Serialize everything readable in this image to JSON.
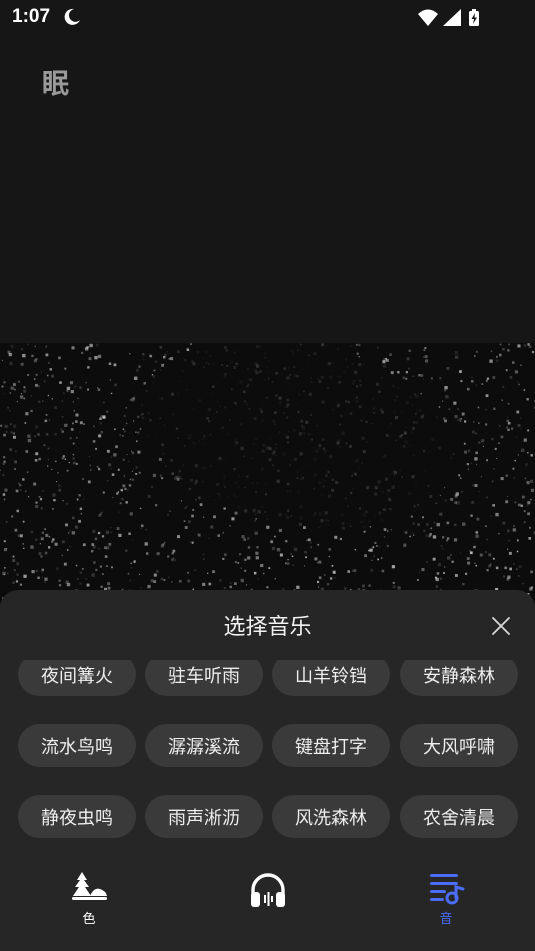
{
  "status_bar": {
    "time": "1:07"
  },
  "app": {
    "logo_text": "眠"
  },
  "sheet": {
    "title": "选择音乐",
    "sounds": [
      "夜间篝火",
      "驻车听雨",
      "山羊铃铛",
      "安静森林",
      "流水鸟鸣",
      "潺潺溪流",
      "键盘打字",
      "大风呼啸",
      "静夜虫鸣",
      "雨声淅沥",
      "风洗森林",
      "农舍清晨"
    ]
  },
  "bottom_nav": {
    "items": [
      {
        "label": "色",
        "icon": "landscape-icon"
      },
      {
        "label": "",
        "icon": "headphones-icon"
      },
      {
        "label": "音",
        "icon": "playlist-music-icon"
      }
    ],
    "active_color": "#4a6cf7"
  }
}
